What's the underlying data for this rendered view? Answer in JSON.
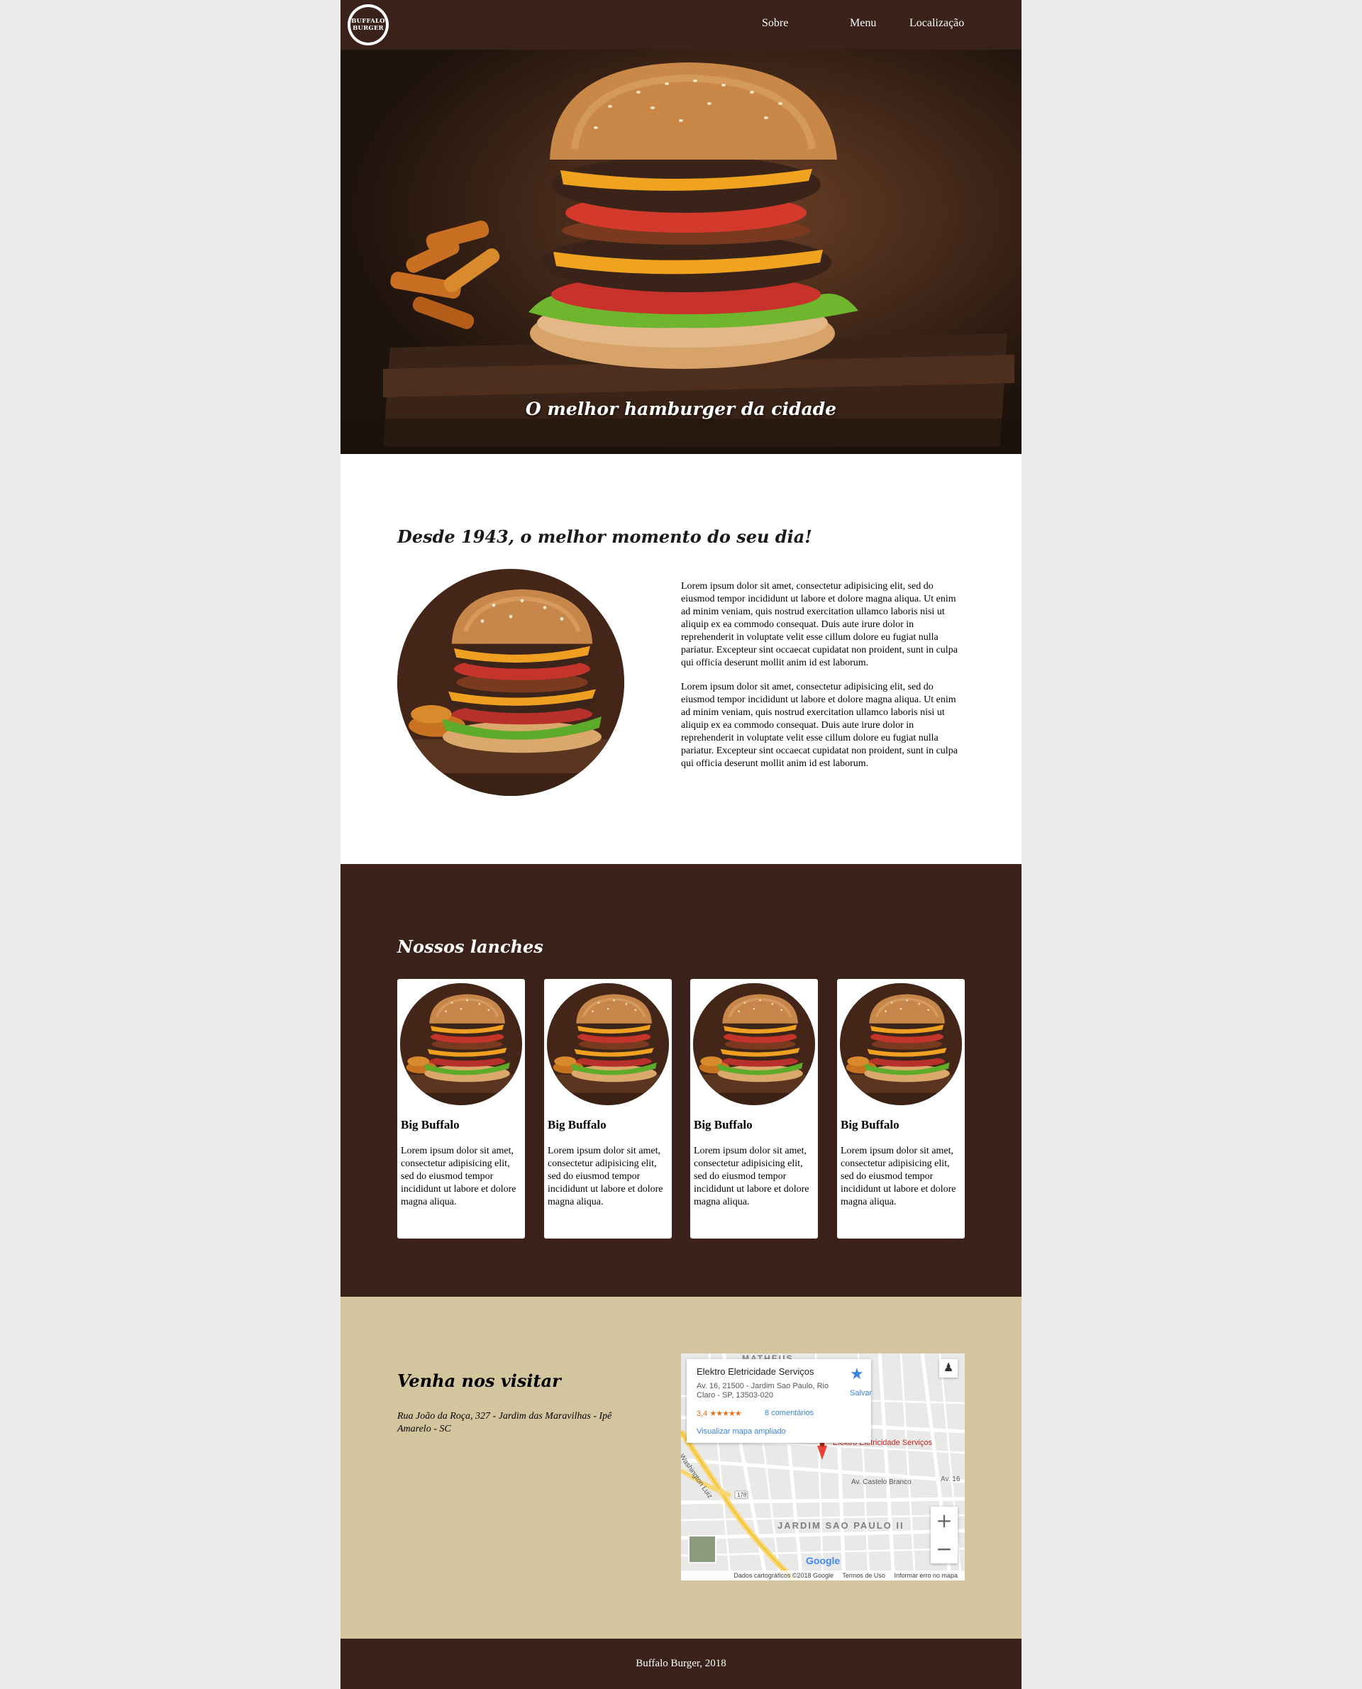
{
  "header": {
    "logo_line1": "BUFFALO",
    "logo_line2": "BURGER",
    "nav": [
      "Sobre",
      "Menu",
      "Localização"
    ]
  },
  "hero": {
    "caption": "O melhor hamburger da cidade"
  },
  "about": {
    "title": "Desde 1943, o melhor momento do seu dia!",
    "paragraphs": [
      "Lorem ipsum dolor sit amet, consectetur adipisicing elit, sed do eiusmod tempor incididunt ut labore et dolore magna aliqua. Ut enim ad minim veniam, quis nostrud exercitation ullamco laboris nisi ut aliquip ex ea commodo consequat. Duis aute irure dolor in reprehenderit in voluptate velit esse cillum dolore eu fugiat nulla pariatur. Excepteur sint occaecat cupidatat non proident, sunt in culpa qui officia deserunt mollit anim id est laborum.",
      "Lorem ipsum dolor sit amet, consectetur adipisicing elit, sed do eiusmod tempor incididunt ut labore et dolore magna aliqua. Ut enim ad minim veniam, quis nostrud exercitation ullamco laboris nisi ut aliquip ex ea commodo consequat. Duis aute irure dolor in reprehenderit in voluptate velit esse cillum dolore eu fugiat nulla pariatur. Excepteur sint occaecat cupidatat non proident, sunt in culpa qui officia deserunt mollit anim id est laborum."
    ]
  },
  "menu": {
    "title": "Nossos lanches",
    "items": [
      {
        "name": "Big Buffalo",
        "desc": "Lorem ipsum dolor sit amet, consectetur adipisicing elit, sed do eiusmod tempor incididunt ut labore et dolore magna aliqua."
      },
      {
        "name": "Big Buffalo",
        "desc": "Lorem ipsum dolor sit amet, consectetur adipisicing elit, sed do eiusmod tempor incididunt ut labore et dolore magna aliqua."
      },
      {
        "name": "Big Buffalo",
        "desc": "Lorem ipsum dolor sit amet, consectetur adipisicing elit, sed do eiusmod tempor incididunt ut labore et dolore magna aliqua."
      },
      {
        "name": "Big Buffalo",
        "desc": "Lorem ipsum dolor sit amet, consectetur adipisicing elit, sed do eiusmod tempor incididunt ut labore et dolore magna aliqua."
      }
    ]
  },
  "visit": {
    "title": "Venha nos visitar",
    "address": "Rua João da Roça, 327 - Jardim das Maravilhas - Ipê Amarelo - SC"
  },
  "map": {
    "place_name": "Elektro Eletricidade Serviços",
    "place_address": "Av. 16, 21500 - Jardim Sao Paulo, Rio Claro - SP, 13503-020",
    "rating": "3,4",
    "stars": "★★★★★",
    "reviews": "8 comentários",
    "enlarge_link": "Visualizar mapa ampliado",
    "save_label": "Salvar",
    "marker_label": "Elektro Eletricidade Serviços",
    "top_label": "MATHEUS",
    "district": "JARDIM SAO PAULO II",
    "street_1": "Washington Luiz",
    "street_2": "Av. Castelo Branco",
    "street_3": "Av. 16",
    "route_number": "178",
    "zoom_in": "+",
    "zoom_out": "−",
    "google": "Google",
    "footer_data": "Dados cartográficos ©2018 Google",
    "footer_terms": "Termos de Uso",
    "footer_report": "Informar erro no mapa"
  },
  "footer": {
    "text": "Buffalo Burger, 2018"
  },
  "colors": {
    "brown": "#3a211a",
    "sand": "#d3c59e",
    "background": "#ebebeb"
  }
}
